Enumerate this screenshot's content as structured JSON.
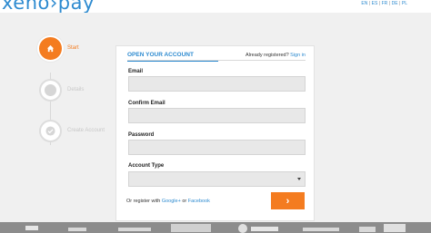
{
  "header": {
    "logo_text": "xeno›pay",
    "languages": [
      "EN",
      "ES",
      "FR",
      "DE",
      "PL"
    ]
  },
  "steps": [
    {
      "label": "Start",
      "state": "active",
      "icon": "home-icon"
    },
    {
      "label": "Details",
      "state": "inactive",
      "icon": "circle-icon"
    },
    {
      "label": "Create Account",
      "state": "inactive",
      "icon": "circle-icon"
    }
  ],
  "form": {
    "title": "OPEN YOUR ACCOUNT",
    "already_text": "Already registered?",
    "signin_label": "Sign in",
    "fields": {
      "email": {
        "label": "Email",
        "value": ""
      },
      "confirm_email": {
        "label": "Confirm Email",
        "value": ""
      },
      "password": {
        "label": "Password",
        "value": ""
      },
      "account_type": {
        "label": "Account Type",
        "value": ""
      }
    },
    "social_prefix": "Or register with",
    "google_label": "Google+",
    "or_text": "or",
    "facebook_label": "Facebook",
    "submit_glyph": "›"
  },
  "colors": {
    "brand_blue": "#2e8bd0",
    "accent_orange": "#f47c20"
  }
}
